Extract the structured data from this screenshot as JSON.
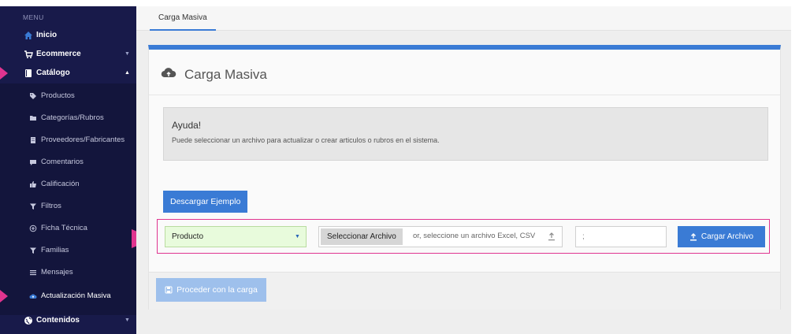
{
  "sidebar": {
    "menu_title": "MENU",
    "items": [
      {
        "label": "Inicio",
        "icon": "home-icon"
      },
      {
        "label": "Ecommerce",
        "icon": "cart-icon"
      },
      {
        "label": "Catálogo",
        "icon": "book-icon"
      },
      {
        "label": "Contenidos",
        "icon": "globe-icon"
      }
    ],
    "sub_items": [
      {
        "label": "Productos",
        "icon": "tag-icon"
      },
      {
        "label": "Categorías/Rubros",
        "icon": "folder-icon"
      },
      {
        "label": "Proveedores/Fabricantes",
        "icon": "building-icon"
      },
      {
        "label": "Comentarios",
        "icon": "comment-icon"
      },
      {
        "label": "Calificación",
        "icon": "thumbs-up-icon"
      },
      {
        "label": "Filtros",
        "icon": "filter-icon"
      },
      {
        "label": "Ficha Técnica",
        "icon": "plus-circle-icon"
      },
      {
        "label": "Familias",
        "icon": "filter-icon"
      },
      {
        "label": "Mensajes",
        "icon": "list-icon"
      },
      {
        "label": "Actualización Masiva",
        "icon": "cloud-upload-icon"
      }
    ]
  },
  "tabs": [
    {
      "label": "Carga Masiva",
      "active": true
    }
  ],
  "card": {
    "title": "Carga Masiva",
    "help_title": "Ayuda!",
    "help_text": "Puede seleccionar un archivo para actualizar o crear articulos o rubros en el sistema.",
    "download_button": "Descargar Ejemplo",
    "type_select_value": "Producto",
    "file_button": "Seleccionar Archivo",
    "file_placeholder": "or, seleccione un archivo Excel, CSV o",
    "separator_value": ";",
    "upload_button": "Cargar Archivo",
    "proceed_button": "Proceder con la carga"
  },
  "colors": {
    "sidebar_bg": "#181a4a",
    "accent": "#3a7bd5",
    "highlight": "#e0348f",
    "select_bg": "#e8fbdc"
  }
}
